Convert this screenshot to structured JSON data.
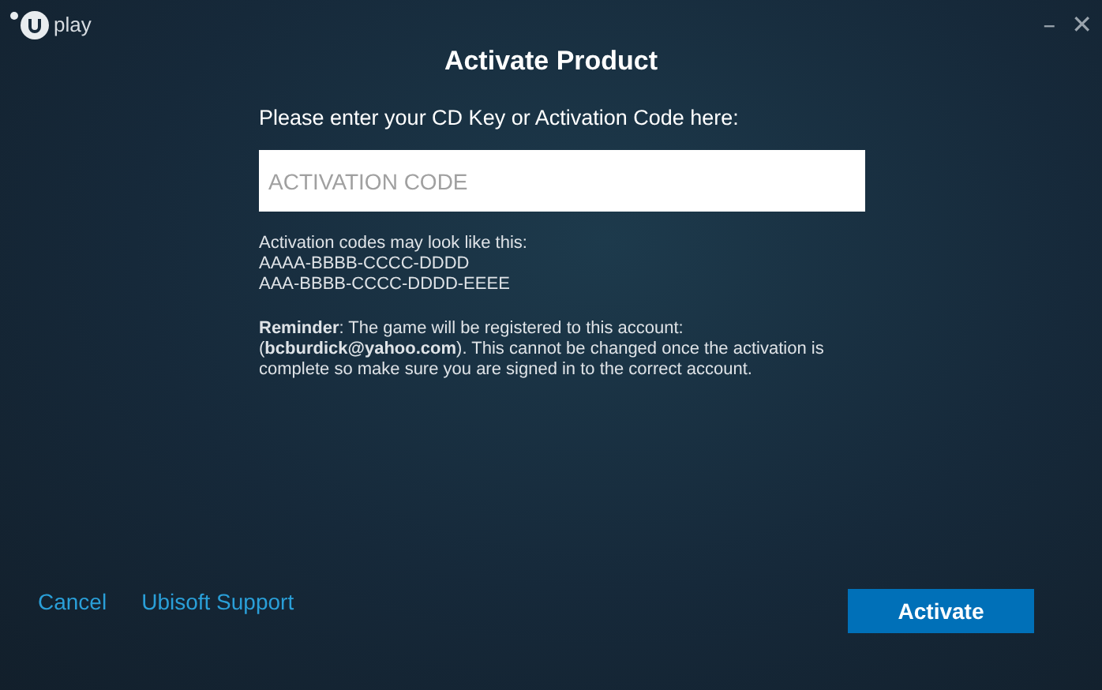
{
  "window": {
    "logo_text": "play",
    "minimize": "–",
    "close": "✕"
  },
  "title": "Activate Product",
  "prompt": "Please enter your CD Key or Activation Code here:",
  "code_field": {
    "placeholder": "ACTIVATION CODE"
  },
  "help": [
    "Activation codes may look like this:",
    "AAAA-BBBB-CCCC-DDDD",
    "AAA-BBBB-CCCC-DDDD-EEEE"
  ],
  "reminder": "**Reminder**: The game will be registered to this account: (**bcburdick@yahoo.com**). This cannot be changed once the activation is complete so make sure you are signed in to the correct account.",
  "links": [
    "Cancel",
    "Ubisoft Support"
  ],
  "button": "Activate"
}
